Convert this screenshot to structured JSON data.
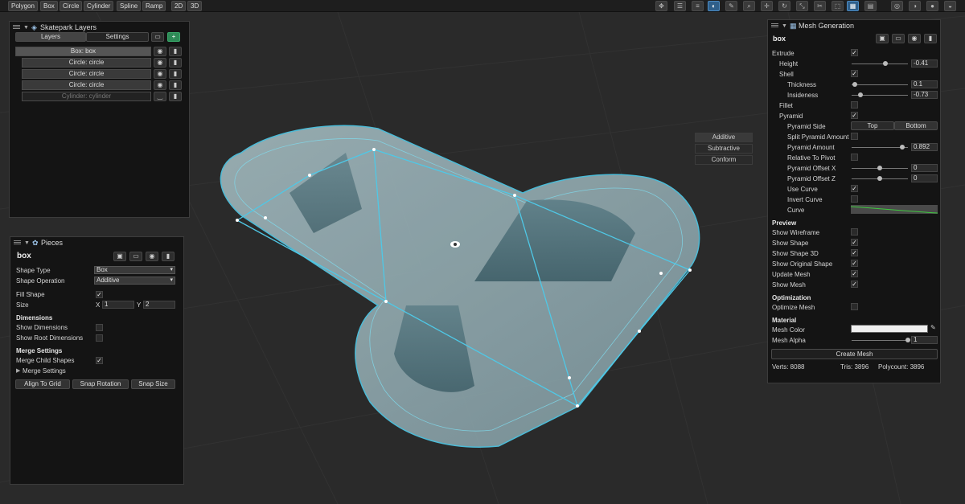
{
  "toolbar": {
    "shapes": [
      "Polygon",
      "Box",
      "Circle",
      "Cylinder",
      "Spline",
      "Ramp"
    ],
    "views": [
      "2D",
      "3D"
    ],
    "right_icons": [
      "move-icon",
      "align-icon",
      "sliders-icon",
      "sphere-icon",
      "brush-icon",
      "select-icon",
      "zoom-icon",
      "pan-icon",
      "rotate-icon",
      "scale-icon",
      "cut-icon",
      "grid-icon",
      "table-icon"
    ],
    "shading_icons": [
      "globe-icon",
      "halfmoon-icon",
      "solid-icon",
      "circle-icon",
      "sun-icon"
    ]
  },
  "layers_panel": {
    "title": "Skatepark Layers",
    "tab_layers": "Layers",
    "tab_settings": "Settings",
    "items": [
      {
        "label": "Box: box",
        "selected": true
      },
      {
        "label": "Circle: circle",
        "selected": false
      },
      {
        "label": "Circle: circle",
        "selected": false
      },
      {
        "label": "Circle: circle",
        "selected": false
      },
      {
        "label": "Cylinder: cylinder",
        "selected": false,
        "dim": true
      }
    ]
  },
  "pieces_panel": {
    "title": "Pieces",
    "name": "box",
    "shape_type_label": "Shape Type",
    "shape_type_value": "Box",
    "shape_operation_label": "Shape Operation",
    "shape_operation_value": "Additive",
    "fill_shape_label": "Fill Shape",
    "size_label": "Size",
    "size_x_label": "X",
    "size_x": "1",
    "size_y_label": "Y",
    "size_y": "2",
    "dimensions_header": "Dimensions",
    "show_dimensions": "Show Dimensions",
    "show_root_dimensions": "Show Root Dimensions",
    "merge_header": "Merge Settings",
    "merge_child_shapes": "Merge Child Shapes",
    "merge_settings_foldout": "Merge Settings",
    "align_to_grid": "Align To Grid",
    "snap_rotation": "Snap Rotation",
    "snap_size": "Snap Size"
  },
  "operation_buttons": [
    "Additive",
    "Subtractive",
    "Conform"
  ],
  "mesh_panel": {
    "title": "Mesh Generation",
    "name": "box",
    "extrude": "Extrude",
    "height": "Height",
    "height_value": "-0.41",
    "height_slider": 0.6,
    "shell": "Shell",
    "thickness": "Thickness",
    "thickness_value": "0.1",
    "thickness_slider": 0.05,
    "insideness": "Insideness",
    "insideness_value": "-0.73",
    "insideness_slider": 0.15,
    "fillet": "Fillet",
    "pyramid": "Pyramid",
    "pyramid_side": "Pyramid Side",
    "pyramid_side_top": "Top",
    "pyramid_side_bottom": "Bottom",
    "split_pyramid_amount": "Split Pyramid Amount",
    "pyramid_amount": "Pyramid Amount",
    "pyramid_amount_value": "0.892",
    "pyramid_amount_slider": 0.9,
    "relative_to_pivot": "Relative To Pivot",
    "pyramid_offset_x": "Pyramid Offset X",
    "pyramid_offset_x_value": "0",
    "pyramid_offset_x_slider": 0.5,
    "pyramid_offset_z": "Pyramid Offset Z",
    "pyramid_offset_z_value": "0",
    "pyramid_offset_z_slider": 0.5,
    "use_curve": "Use Curve",
    "invert_curve": "Invert Curve",
    "curve": "Curve",
    "preview_header": "Preview",
    "show_wireframe": "Show Wireframe",
    "show_shape": "Show Shape",
    "show_shape_3d": "Show Shape 3D",
    "show_original_shape": "Show Original Shape",
    "update_mesh": "Update Mesh",
    "show_mesh": "Show Mesh",
    "optimization_header": "Optimization",
    "optimize_mesh": "Optimize Mesh",
    "material_header": "Material",
    "mesh_color": "Mesh Color",
    "mesh_alpha": "Mesh Alpha",
    "mesh_alpha_value": "1",
    "mesh_alpha_slider": 1.0,
    "create_mesh": "Create Mesh",
    "verts": "Verts: 8088",
    "tris": "Tris: 3896",
    "polycount": "Polycount: 3896"
  },
  "colors": {
    "viewport_bg": "#2a2a2a",
    "grid_line": "#333333",
    "mesh_fill": "#a9c3c9",
    "mesh_outline": "#4fc8e6",
    "accent_green": "#2e8b57"
  }
}
